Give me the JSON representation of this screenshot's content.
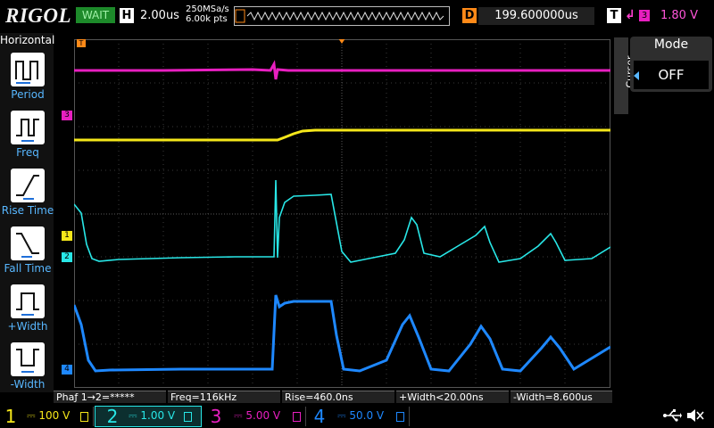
{
  "header": {
    "brand": "RIGOL",
    "run_status": "WAIT",
    "horizontal_badge": "H",
    "timebase": "2.00us",
    "sample_rate": "250MSa/s",
    "memory_depth": "6.00k pts",
    "delay_badge": "D",
    "delay_value": "199.600000us",
    "trigger_badge": "T",
    "trigger_source": "3",
    "trigger_level": "1.80 V"
  },
  "left_menu": {
    "title": "Horizontal",
    "items": [
      {
        "label": "Period",
        "icon": "period-icon"
      },
      {
        "label": "Freq",
        "icon": "freq-icon"
      },
      {
        "label": "Rise Time",
        "icon": "rise-time-icon"
      },
      {
        "label": "Fall Time",
        "icon": "fall-time-icon"
      },
      {
        "label": "+Width",
        "icon": "pos-width-icon"
      },
      {
        "label": "-Width",
        "icon": "neg-width-icon"
      }
    ]
  },
  "right_panel": {
    "tab_label": "Cursor",
    "mode_title": "Mode",
    "mode_value": "OFF"
  },
  "measurements": [
    "Phaƒ 1→2=*****",
    "Freq=116kHz",
    "Rise=460.0ns",
    "+Width<20.00ns",
    "-Width=8.600us"
  ],
  "channels": [
    {
      "num": "1",
      "scale": "100 V",
      "color": "#f5e71a"
    },
    {
      "num": "2",
      "scale": "1.00 V",
      "color": "#28e7e7"
    },
    {
      "num": "3",
      "scale": "5.00 V",
      "color": "#e81fc0"
    },
    {
      "num": "4",
      "scale": "50.0 V",
      "color": "#1e88ff"
    }
  ],
  "markers": {
    "ch1": "1",
    "ch2": "2",
    "ch3": "3",
    "ch4": "4",
    "trigger_level_marker": "T"
  },
  "colors": {
    "ch1": "#f5e71a",
    "ch2": "#28e7e7",
    "ch3": "#e81fc0",
    "ch4": "#1e88ff",
    "accent_orange": "#ff8a18",
    "menu_label": "#58b7ff",
    "status_green": "#1d8a2a"
  }
}
